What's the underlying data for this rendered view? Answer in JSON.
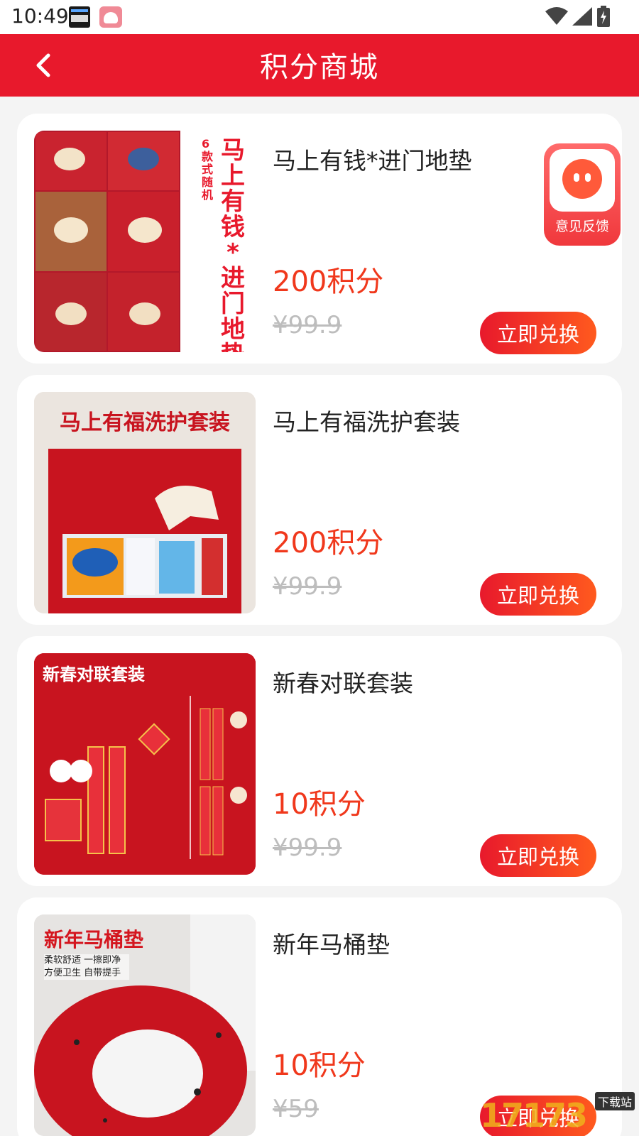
{
  "status_bar": {
    "time": "10:49",
    "icons": [
      "notification-app-icon",
      "notification-app-icon",
      "wifi-icon",
      "signal-icon",
      "battery-charging-icon"
    ]
  },
  "header": {
    "title": "积分商城",
    "back_icon": "chevron-left-icon"
  },
  "products": [
    {
      "name": "马上有钱*进门地垫",
      "points": "200积分",
      "original_price": "¥99.9",
      "button": "立即兑换",
      "image_text": "马上有钱*进门地垫",
      "image_subtext": "6款式随机"
    },
    {
      "name": "马上有福洗护套装",
      "points": "200积分",
      "original_price": "¥99.9",
      "button": "立即兑换",
      "image_text": "马上有福洗护套装"
    },
    {
      "name": "新春对联套装",
      "points": "10积分",
      "original_price": "¥99.9",
      "button": "立即兑换",
      "image_text": "新春对联套装"
    },
    {
      "name": "新年马桶垫",
      "points": "10积分",
      "original_price": "¥59",
      "button": "立即兑换",
      "image_text": "新年马桶垫",
      "image_subtext": "柔软舒适 一擦即净 方便卫生 自带提手"
    }
  ],
  "feedback": {
    "label": "意见反馈",
    "icon": "headset-face-icon"
  },
  "watermark": {
    "brand": "17173",
    "tag": "下载站"
  },
  "colors": {
    "header_red": "#e8192c",
    "points_red": "#f0381c",
    "button_gradient_end": "#ff5a1e"
  }
}
